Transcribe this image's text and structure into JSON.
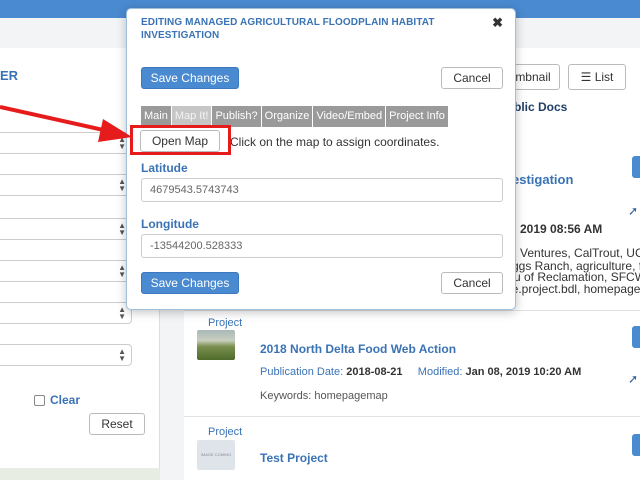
{
  "left": {
    "title": "ER",
    "clear_label": "Clear",
    "reset_label": "Reset"
  },
  "right": {
    "thumbnail_label": "mbnail",
    "list_label": "List",
    "list_icon": "list-icon",
    "public_docs": "blic Docs",
    "first_project": {
      "title_fragment": "estigation",
      "date_fragment": "2019 08:56 AM",
      "partners_lines": [
        "Ventures, CalTrout, UC D",
        "ggs Ranch, agriculture, fi",
        "u of Reclamation, SFCWA",
        "le.project.bdl, homepage"
      ]
    },
    "projects": [
      {
        "type": "Project",
        "title": "2018 North Delta Food Web Action",
        "publication_label": "Publication Date:",
        "publication_date": "2018-08-21",
        "modified_label": "Modified:",
        "modified_date": "Jan 08, 2019 10:20 AM",
        "keywords": "Keywords: homepagemap"
      },
      {
        "type": "Project",
        "title": "Test Project",
        "thumb_text": "IMAGE COMING SOON"
      }
    ]
  },
  "modal": {
    "title": "EDITING MANAGED AGRICULTURAL FLOODPLAIN HABITAT INVESTIGATION",
    "close_glyph": "✖",
    "save_label": "Save Changes",
    "cancel_label": "Cancel",
    "tabs": [
      "Main",
      "Map It!",
      "Publish?",
      "Organize",
      "Video/Embed",
      "Project Info"
    ],
    "active_tab": "Map It!",
    "open_map_label": "Open Map",
    "map_hint": "Click on the map to assign coordinates.",
    "latitude_label": "Latitude",
    "latitude_value": "4679543.5743743",
    "longitude_label": "Longitude",
    "longitude_value": "-13544200.528333"
  },
  "colors": {
    "accent": "#4a8ad0",
    "annotation": "#e61c1c",
    "link": "#3a73b5"
  }
}
